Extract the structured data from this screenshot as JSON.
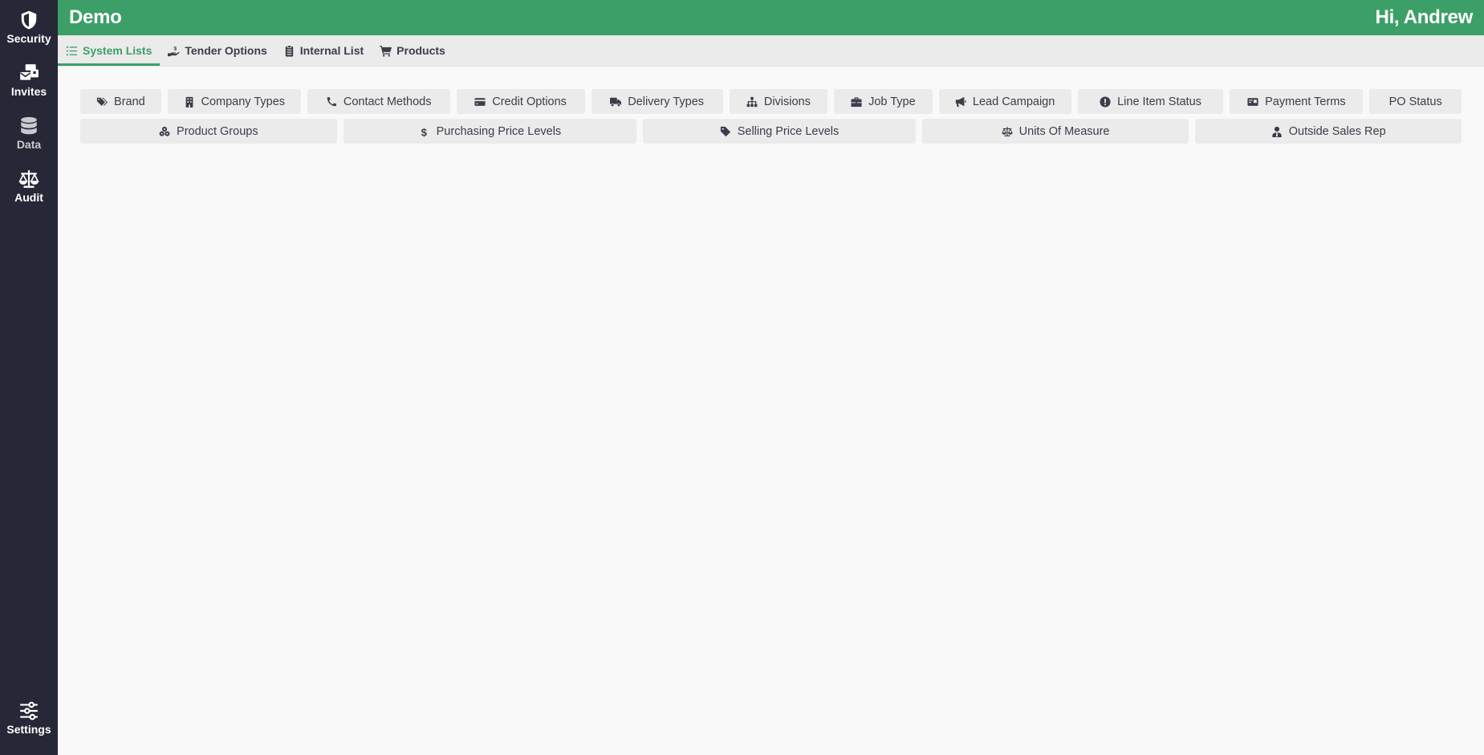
{
  "sidebar": {
    "items": [
      {
        "label": "Security",
        "icon": "shield-icon"
      },
      {
        "label": "Invites",
        "icon": "envelope-stack-icon"
      },
      {
        "label": "Data",
        "icon": "database-icon"
      },
      {
        "label": "Audit",
        "icon": "balance-scale-icon"
      }
    ],
    "bottom": {
      "label": "Settings",
      "icon": "sliders-icon"
    }
  },
  "header": {
    "title": "Demo",
    "greeting": "Hi, Andrew",
    "color": "#3d9f68"
  },
  "tabs": [
    {
      "label": "System Lists",
      "icon": "list-icon",
      "active": true
    },
    {
      "label": "Tender Options",
      "icon": "hand-dollar-icon",
      "active": false
    },
    {
      "label": "Internal List",
      "icon": "clipboard-icon",
      "active": false
    },
    {
      "label": "Products",
      "icon": "cart-icon",
      "active": false
    }
  ],
  "lists": {
    "row1": [
      {
        "label": "Brand",
        "icon": "tags-icon"
      },
      {
        "label": "Company Types",
        "icon": "building-icon"
      },
      {
        "label": "Contact Methods",
        "icon": "phone-icon"
      },
      {
        "label": "Credit Options",
        "icon": "credit-card-icon"
      },
      {
        "label": "Delivery Types",
        "icon": "truck-icon"
      },
      {
        "label": "Divisions",
        "icon": "sitemap-icon"
      },
      {
        "label": "Job Type",
        "icon": "briefcase-icon"
      },
      {
        "label": "Lead Campaign",
        "icon": "bullhorn-icon"
      },
      {
        "label": "Line Item Status",
        "icon": "exclamation-circle-icon"
      },
      {
        "label": "Payment Terms",
        "icon": "id-card-icon"
      },
      {
        "label": "PO Status",
        "icon": ""
      }
    ],
    "row2": [
      {
        "label": "Product Groups",
        "icon": "cubes-icon"
      },
      {
        "label": "Purchasing Price Levels",
        "icon": "dollar-icon"
      },
      {
        "label": "Selling Price Levels",
        "icon": "tag-icon"
      },
      {
        "label": "Units Of Measure",
        "icon": "balance-scale-icon"
      },
      {
        "label": "Outside Sales Rep",
        "icon": "user-tie-icon"
      }
    ]
  }
}
